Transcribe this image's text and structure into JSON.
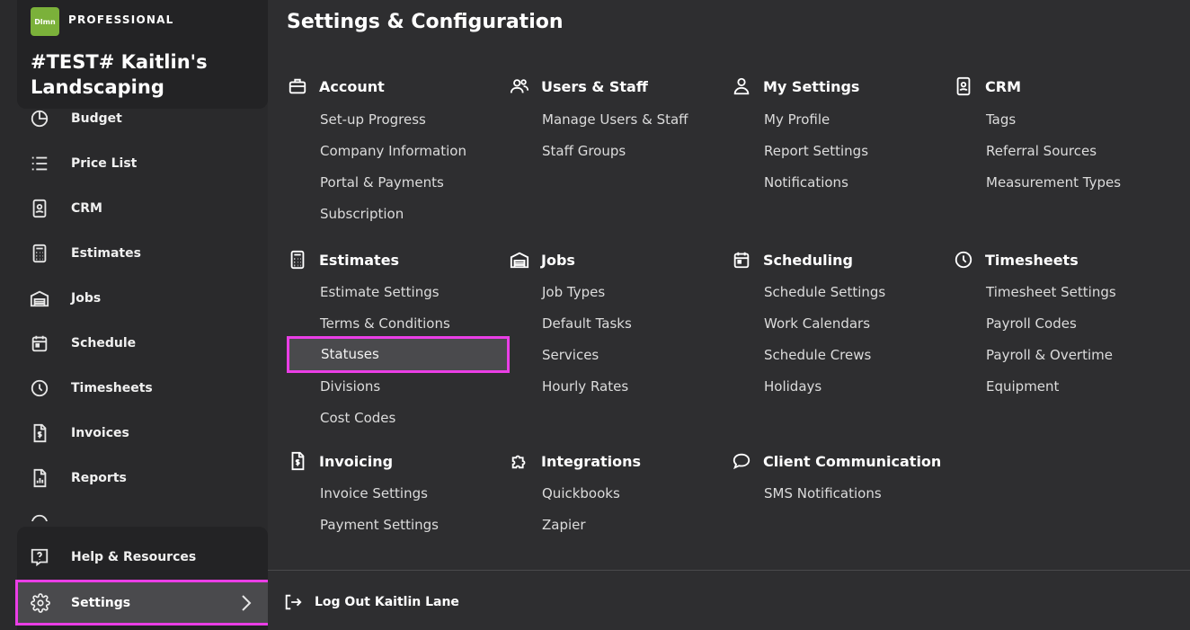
{
  "brand": {
    "logo_text": "Dlmn",
    "tier": "PROFESSIONAL",
    "company": "#TEST# Kaitlin's Landscaping"
  },
  "sidebar": {
    "items": [
      {
        "label": "Budget",
        "icon": "budget-icon"
      },
      {
        "label": "Price List",
        "icon": "list-icon"
      },
      {
        "label": "CRM",
        "icon": "contact-card-icon"
      },
      {
        "label": "Estimates",
        "icon": "calculator-icon"
      },
      {
        "label": "Jobs",
        "icon": "garage-icon"
      },
      {
        "label": "Schedule",
        "icon": "calendar-icon"
      },
      {
        "label": "Timesheets",
        "icon": "clock-icon"
      },
      {
        "label": "Invoices",
        "icon": "invoice-icon"
      },
      {
        "label": "Reports",
        "icon": "report-icon"
      }
    ],
    "help_label": "Help & Resources",
    "settings_label": "Settings"
  },
  "main": {
    "title": "Settings & Configuration",
    "sections": [
      {
        "title": "Account",
        "icon": "briefcase-icon",
        "links": [
          "Set-up Progress",
          "Company Information",
          "Portal & Payments",
          "Subscription"
        ]
      },
      {
        "title": "Users & Staff",
        "icon": "users-icon",
        "links": [
          "Manage Users & Staff",
          "Staff Groups"
        ]
      },
      {
        "title": "My Settings",
        "icon": "person-icon",
        "links": [
          "My Profile",
          "Report Settings",
          "Notifications"
        ]
      },
      {
        "title": "CRM",
        "icon": "contact-card-icon",
        "links": [
          "Tags",
          "Referral Sources",
          "Measurement Types"
        ]
      },
      {
        "title": "Estimates",
        "icon": "calculator-icon",
        "links": [
          "Estimate Settings",
          "Terms & Conditions",
          "Statuses",
          "Divisions",
          "Cost Codes"
        ]
      },
      {
        "title": "Jobs",
        "icon": "garage-icon",
        "links": [
          "Job Types",
          "Default Tasks",
          "Services",
          "Hourly Rates"
        ]
      },
      {
        "title": "Scheduling",
        "icon": "calendar-icon",
        "links": [
          "Schedule Settings",
          "Work Calendars",
          "Schedule Crews",
          "Holidays"
        ]
      },
      {
        "title": "Timesheets",
        "icon": "clock-icon",
        "links": [
          "Timesheet Settings",
          "Payroll Codes",
          "Payroll & Overtime",
          "Equipment"
        ]
      },
      {
        "title": "Invoicing",
        "icon": "invoice-icon",
        "links": [
          "Invoice Settings",
          "Payment Settings"
        ]
      },
      {
        "title": "Integrations",
        "icon": "puzzle-icon",
        "links": [
          "Quickbooks",
          "Zapier"
        ]
      },
      {
        "title": "Client Communication",
        "icon": "chat-bubble-icon",
        "links": [
          "SMS Notifications"
        ]
      }
    ],
    "logout_label": "Log Out Kaitlin Lane"
  },
  "colors": {
    "highlight_border": "#ea3ee6",
    "brand_green": "#7bb13a",
    "stripe_green": "#7bb13a",
    "stripe_orange": "#e8942a",
    "stripe_blue": "#2a7fbf"
  }
}
